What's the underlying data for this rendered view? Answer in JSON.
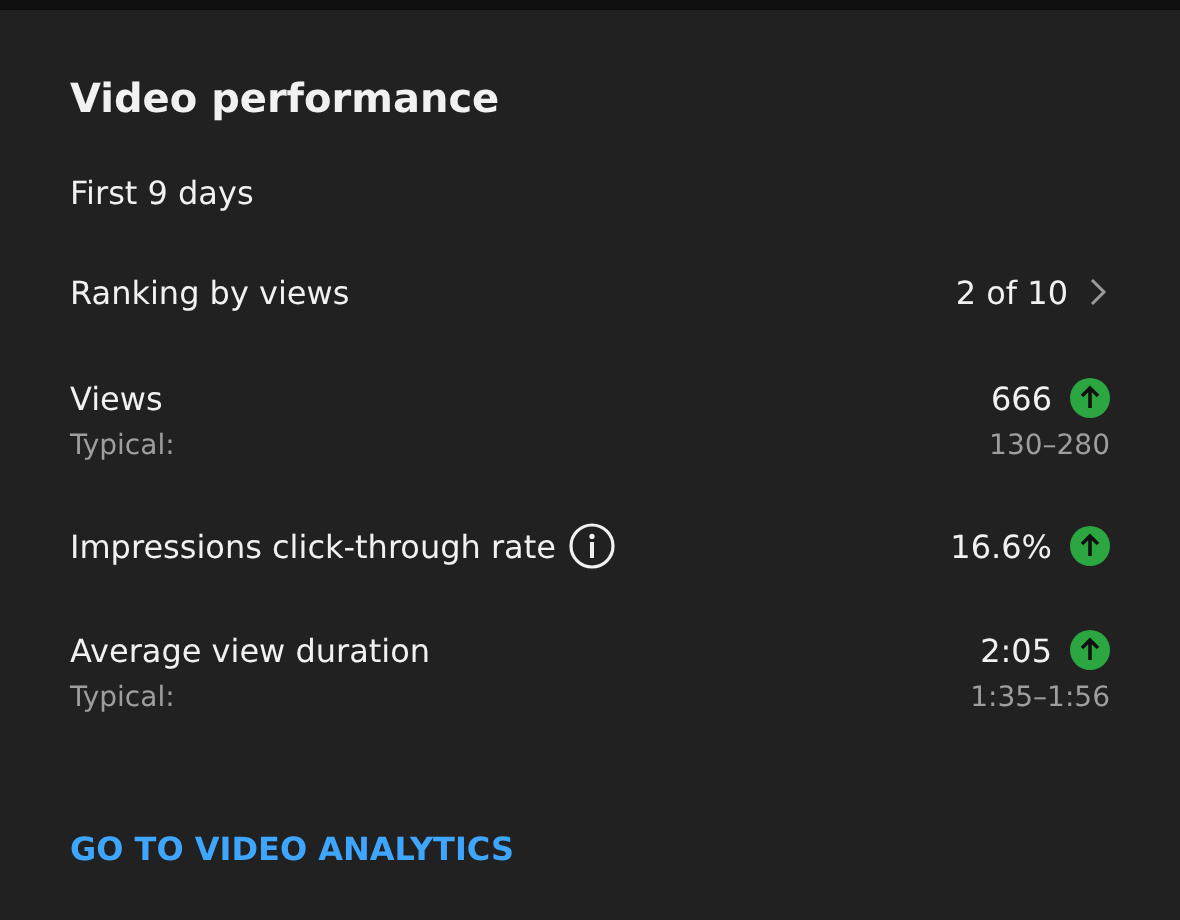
{
  "title": "Video performance",
  "period": "First 9 days",
  "ranking": {
    "label": "Ranking by views",
    "value": "2 of 10"
  },
  "metrics": [
    {
      "label": "Views",
      "value": "666",
      "rising": true,
      "info": false,
      "typical_label": "Typical:",
      "typical_range": "130–280"
    },
    {
      "label": "Impressions click-through rate",
      "value": "16.6%",
      "rising": true,
      "info": true
    },
    {
      "label": "Average view duration",
      "value": "2:05",
      "rising": true,
      "info": false,
      "typical_label": "Typical:",
      "typical_range": "1:35–1:56"
    }
  ],
  "link": "GO TO VIDEO ANALYTICS"
}
